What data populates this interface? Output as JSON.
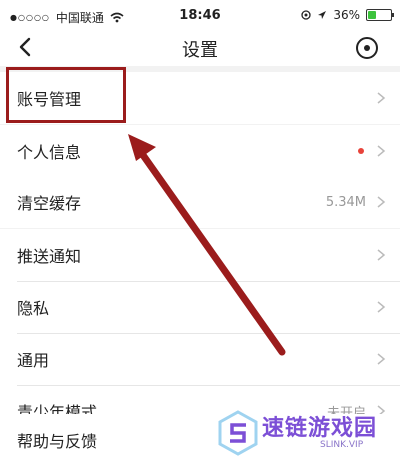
{
  "status_bar": {
    "carrier": "中国联通",
    "time": "18:46",
    "battery": "36%",
    "battery_level": 0.36
  },
  "nav": {
    "title": "设置"
  },
  "groups": [
    [
      {
        "label": "账号管理"
      }
    ],
    [
      {
        "label": "个人信息",
        "badge": "red-dot"
      }
    ],
    [
      {
        "label": "清空缓存",
        "value": "5.34M"
      }
    ],
    [
      {
        "label": "推送通知"
      },
      {
        "label": "隐私"
      },
      {
        "label": "通用"
      },
      {
        "label": "青少年模式",
        "value": "未开启"
      }
    ],
    [
      {
        "label": "帮助与反馈"
      }
    ]
  ],
  "annotation": {
    "color": "#9b1c1c"
  },
  "watermark": {
    "title": "速链游戏园",
    "subtitle": "SLINK.VIP"
  }
}
